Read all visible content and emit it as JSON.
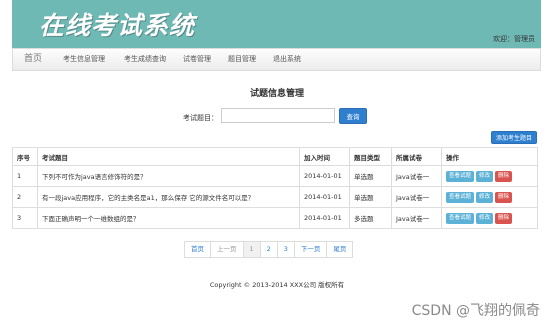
{
  "header": {
    "logo_text": "在线考试系统",
    "welcome": "欢迎：管理员"
  },
  "nav": {
    "home": "首页",
    "items": [
      "考生信息管理",
      "考生成绩查询",
      "试卷管理",
      "题目管理",
      "退出系统"
    ]
  },
  "page_title": "试题信息管理",
  "search": {
    "label": "考试题目：",
    "value": "",
    "button": "查询"
  },
  "add_button": "添加考生题目",
  "table": {
    "headers": [
      "序号",
      "考试题目",
      "加入时间",
      "题目类型",
      "所属试卷",
      "操作"
    ],
    "rows": [
      {
        "no": "1",
        "question": "下列不可作为java语言修饰符的是？",
        "date": "2014-01-01",
        "type": "单选题",
        "paper": "Java试卷一"
      },
      {
        "no": "2",
        "question": "有一段java应用程序，它的主类名是a1，那么保存 它的源文件名可以是？",
        "date": "2014-01-01",
        "type": "单选题",
        "paper": "Java试卷一"
      },
      {
        "no": "3",
        "question": "下面正确声明一个一维数组的是？",
        "date": "2014-01-01",
        "type": "多选题",
        "paper": "Java试卷一"
      }
    ],
    "actions": {
      "view": "查看试题",
      "edit": "修改",
      "delete": "删除"
    }
  },
  "pagination": {
    "first": "首页",
    "prev": "上一页",
    "pages": [
      "1",
      "2",
      "3"
    ],
    "current": "1",
    "next": "下一页",
    "last": "尾页"
  },
  "footer": "Copyright © 2013-2014 XXX公司 版权所有",
  "watermark": "CSDN @飞翔的佩奇",
  "colors": {
    "header_bg": "#6fb9b5",
    "primary": "#2f7fcf",
    "info": "#5bb1d6",
    "danger": "#d9534f"
  }
}
